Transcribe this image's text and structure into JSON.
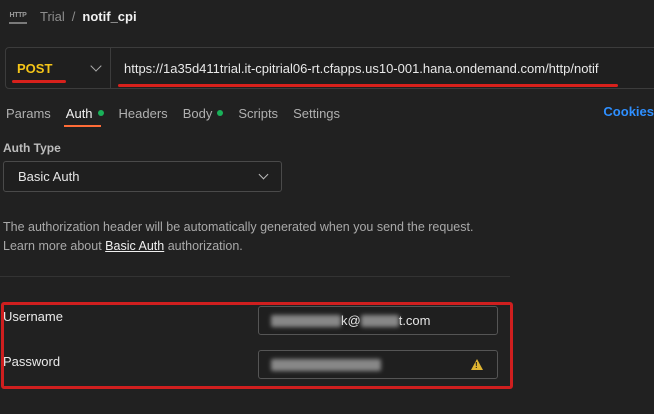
{
  "breadcrumb": {
    "icon": "http-icon",
    "icon_text": "HTTP",
    "workspace": "Trial",
    "separator": "/",
    "request_name": "notif_cpi"
  },
  "request": {
    "method": "POST",
    "url": "https://1a35d411trial.it-cpitrial06-rt.cfapps.us10-001.hana.ondemand.com/http/notif"
  },
  "tabs": [
    {
      "label": "Params",
      "active": false,
      "dot": false
    },
    {
      "label": "Auth",
      "active": true,
      "dot": true
    },
    {
      "label": "Headers",
      "active": false,
      "dot": false
    },
    {
      "label": "Body",
      "active": false,
      "dot": true
    },
    {
      "label": "Scripts",
      "active": false,
      "dot": false
    },
    {
      "label": "Settings",
      "active": false,
      "dot": false
    }
  ],
  "cookies_label": "Cookies",
  "auth": {
    "type_label": "Auth Type",
    "type_value": "Basic Auth",
    "description_line1": "The authorization header will be automatically generated when you send the request.",
    "description_prefix": "Learn more about",
    "description_link": "Basic Auth",
    "description_suffix": "authorization.",
    "username_label": "Username",
    "username_visible_part1": "k@",
    "username_visible_part2": "t.com",
    "password_label": "Password"
  },
  "colors": {
    "accent_tab": "#ff6c37",
    "method": "#f5c518",
    "annotation_red": "#cf1f1f",
    "link_blue": "#2e8fff",
    "status_dot": "#19b159",
    "warning": "#e0b531"
  }
}
